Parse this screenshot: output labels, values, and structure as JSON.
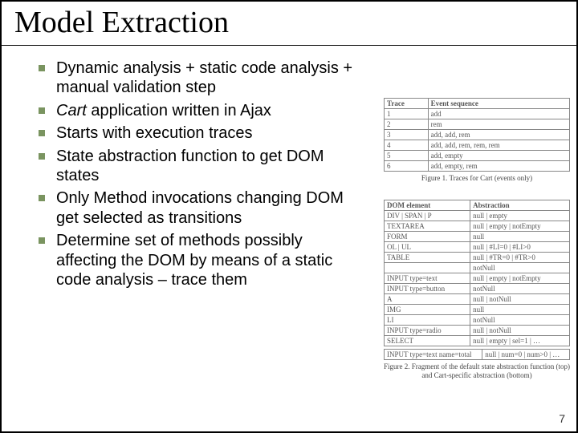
{
  "title": "Model Extraction",
  "bullets": [
    {
      "text": "Dynamic analysis + static code analysis + manual validation step"
    },
    {
      "pre": "",
      "em": "Cart",
      "post": " application written in Ajax"
    },
    {
      "text": "Starts with execution traces"
    },
    {
      "text": "State abstraction function to get DOM states"
    },
    {
      "text": "Only Method invocations changing  DOM get selected as transitions"
    },
    {
      "text": "Determine set of methods possibly affecting the DOM by means of a static code analysis – trace them"
    }
  ],
  "table1": {
    "headers": [
      "Trace",
      "Event sequence"
    ],
    "rows": [
      [
        "1",
        "add"
      ],
      [
        "2",
        "rem"
      ],
      [
        "3",
        "add, add, rem"
      ],
      [
        "4",
        "add, add, rem, rem, rem"
      ],
      [
        "5",
        "add, empty"
      ],
      [
        "6",
        "add, empty, rem"
      ]
    ],
    "caption": "Figure 1. Traces for Cart (events only)"
  },
  "table2": {
    "top": {
      "headers": [
        "DOM element",
        "Abstraction"
      ],
      "rows": [
        [
          "DIV | SPAN | P",
          "null | empty"
        ],
        [
          "TEXTAREA",
          "null | empty | notEmpty"
        ],
        [
          "FORM",
          "null"
        ],
        [
          "OL | UL",
          "null | #LI=0 | #LI>0"
        ],
        [
          "TABLE",
          "null | #TR=0 | #TR>0"
        ],
        [
          "",
          "notNull"
        ],
        [
          "INPUT type=text",
          "null | empty | notEmpty"
        ],
        [
          "INPUT type=button",
          "notNull"
        ],
        [
          "A",
          "null | notNull"
        ],
        [
          "IMG",
          "null"
        ],
        [
          "LI",
          "notNull"
        ],
        [
          "INPUT type=radio",
          "null | notNull"
        ],
        [
          "SELECT",
          "null | empty | sel=1 | …"
        ]
      ]
    },
    "bottom": {
      "rows": [
        [
          "INPUT type=text name=total",
          "null | num=0 | num>0 | …"
        ]
      ]
    },
    "caption": "Figure 2. Fragment of the default state abstraction function (top) and Cart-specific abstraction (bottom)"
  },
  "page_number": "7"
}
